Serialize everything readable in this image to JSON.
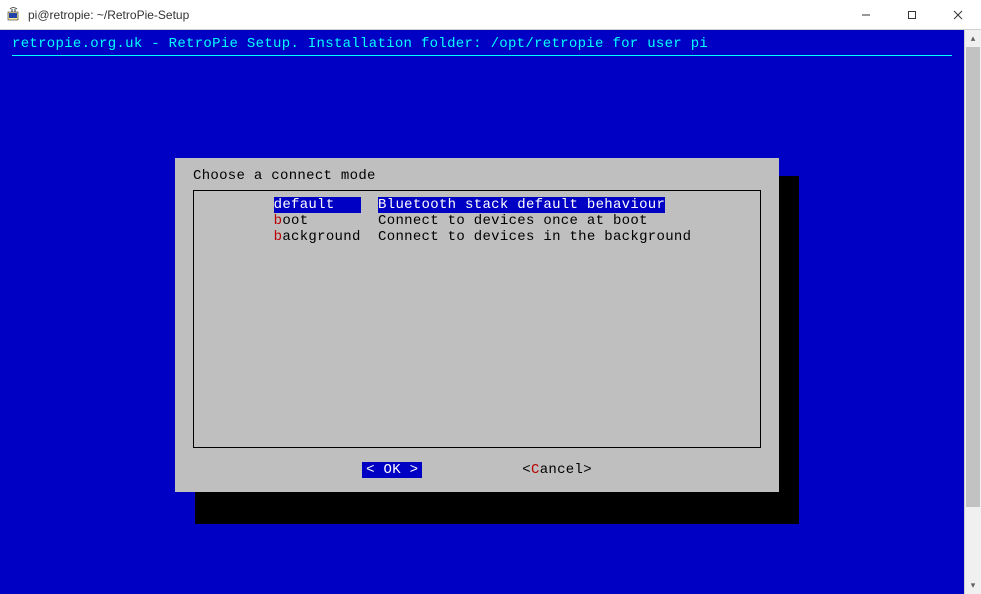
{
  "window": {
    "title": "pi@retropie: ~/RetroPie-Setup"
  },
  "header": {
    "text": "retropie.org.uk - RetroPie Setup. Installation folder: /opt/retropie for user pi"
  },
  "dialog": {
    "prompt": "Choose a connect mode",
    "items": [
      {
        "hotkey": "d",
        "rest": "efault   ",
        "pad": "  ",
        "desc": "Bluetooth stack default behaviour",
        "selected": true
      },
      {
        "hotkey": "b",
        "rest": "oot      ",
        "pad": "  ",
        "desc": "Connect to devices once at boot",
        "selected": false
      },
      {
        "hotkey": "b",
        "rest": "ackground",
        "pad": "  ",
        "desc": "Connect to devices in the background",
        "selected": false
      }
    ],
    "buttons": {
      "ok": {
        "open": "<  ",
        "hotkey": "O",
        "rest": "K  >",
        "active": true
      },
      "cancel": {
        "open": "<",
        "hotkey": "C",
        "rest": "ancel>",
        "active": false
      }
    }
  }
}
